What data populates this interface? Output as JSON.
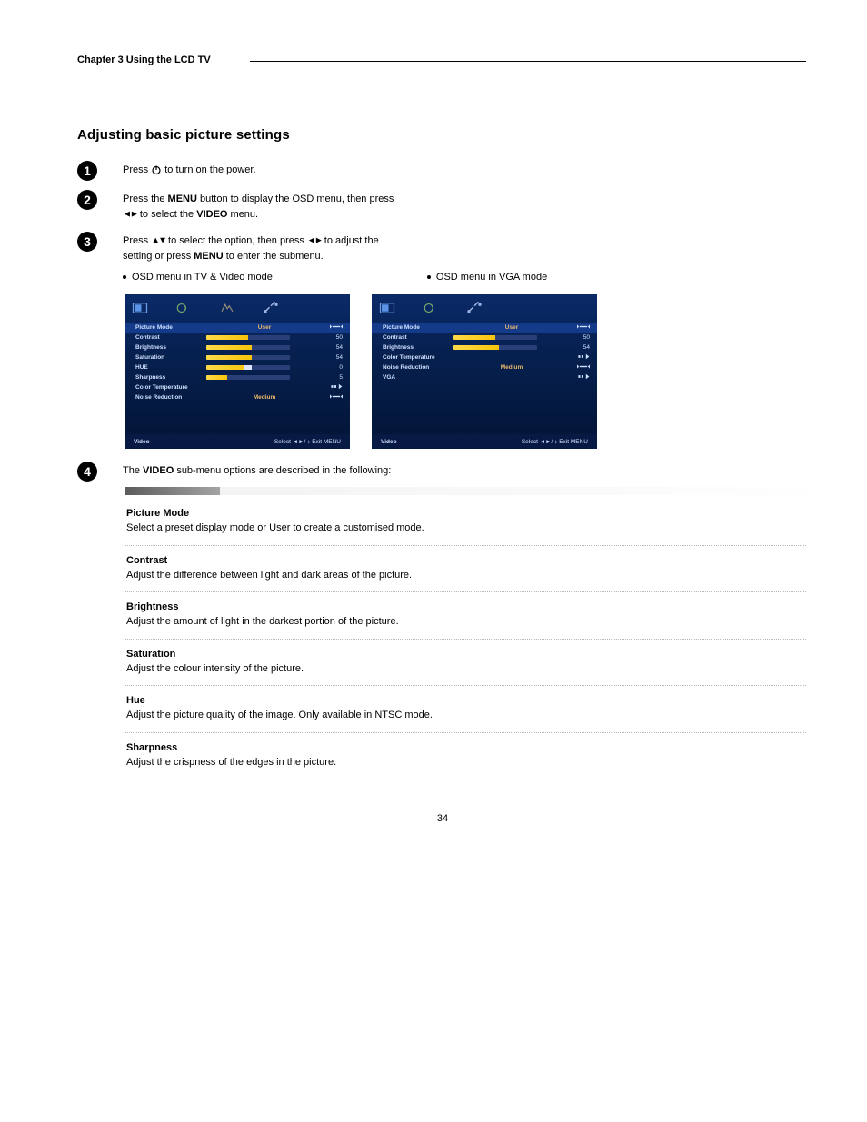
{
  "header": {
    "chapter_title": "Chapter 3 Using the LCD TV"
  },
  "section_title": "Adjusting basic picture settings",
  "steps": {
    "s1": {
      "pre": "Press",
      "icon_name": "power-icon",
      "post": "to turn on the power."
    },
    "s2": {
      "l1a": "Press the ",
      "l1b": "MENU",
      "l1c": " button to display the OSD menu, then press",
      "l2a": "",
      "l2_arrows": "◄►",
      "l2b": " to select the ",
      "l2c": "VIDEO",
      "l2d": " menu."
    },
    "s3": {
      "l1a": "Press ",
      "l1_arrows": "▲▼",
      "l1b": " to select the option, then press ",
      "l1_arrows2": "◄►",
      "l1c": " to adjust the",
      "l2a": "setting or press ",
      "l2b": "MENU",
      "l2c": " to enter the submenu.",
      "bullet": "OSD menu in TV & Video mode",
      "bullet_vga": "OSD menu in VGA mode"
    },
    "s4": {
      "pre": "The ",
      "strong": "VIDEO",
      "post": " sub-menu options are described in the following:"
    }
  },
  "osd_left": {
    "footer_left": "Video",
    "footer_right": "Select ◄►/ ↕  Exit  MENU",
    "rows": [
      {
        "label": "Picture Mode",
        "type": "mode",
        "value": "User"
      },
      {
        "label": "Contrast",
        "type": "bar",
        "pct": 50,
        "value": "50"
      },
      {
        "label": "Brightness",
        "type": "bar",
        "pct": 54,
        "value": "54"
      },
      {
        "label": "Saturation",
        "type": "bar",
        "pct": 54,
        "value": "54"
      },
      {
        "label": "HUE",
        "type": "bar",
        "pct": 50,
        "value": "0",
        "knob": true
      },
      {
        "label": "Sharpness",
        "type": "bar",
        "pct": 25,
        "value": "5"
      },
      {
        "label": "Color Temperature",
        "type": "enter",
        "value": ""
      },
      {
        "label": "Noise Reduction",
        "type": "mode",
        "value": "Medium"
      }
    ]
  },
  "osd_right": {
    "footer_left": "Video",
    "footer_right": "Select ◄►/ ↕  Exit  MENU",
    "rows": [
      {
        "label": "Picture Mode",
        "type": "mode",
        "value": "User"
      },
      {
        "label": "Contrast",
        "type": "bar",
        "pct": 50,
        "value": "50"
      },
      {
        "label": "Brightness",
        "type": "bar",
        "pct": 54,
        "value": "54"
      },
      {
        "label": "Color Temperature",
        "type": "enter",
        "value": ""
      },
      {
        "label": "Noise Reduction",
        "type": "mode",
        "value": "Medium"
      },
      {
        "label": "VGA",
        "type": "enter",
        "value": ""
      }
    ]
  },
  "table": [
    {
      "name": "Picture Mode",
      "desc": "Select a preset display mode or User to create a customised mode."
    },
    {
      "name": "Contrast",
      "desc": "Adjust the difference between light and dark areas of the picture."
    },
    {
      "name": "Brightness",
      "desc": "Adjust the amount of light in the darkest portion of the picture."
    },
    {
      "name": "Saturation",
      "desc": "Adjust the colour intensity of the picture."
    },
    {
      "name": "Hue",
      "desc": "Adjust the picture quality of the image. Only available in NTSC mode."
    },
    {
      "name": "Sharpness",
      "desc": "Adjust the crispness of the edges in the picture."
    }
  ],
  "page_number": "34"
}
